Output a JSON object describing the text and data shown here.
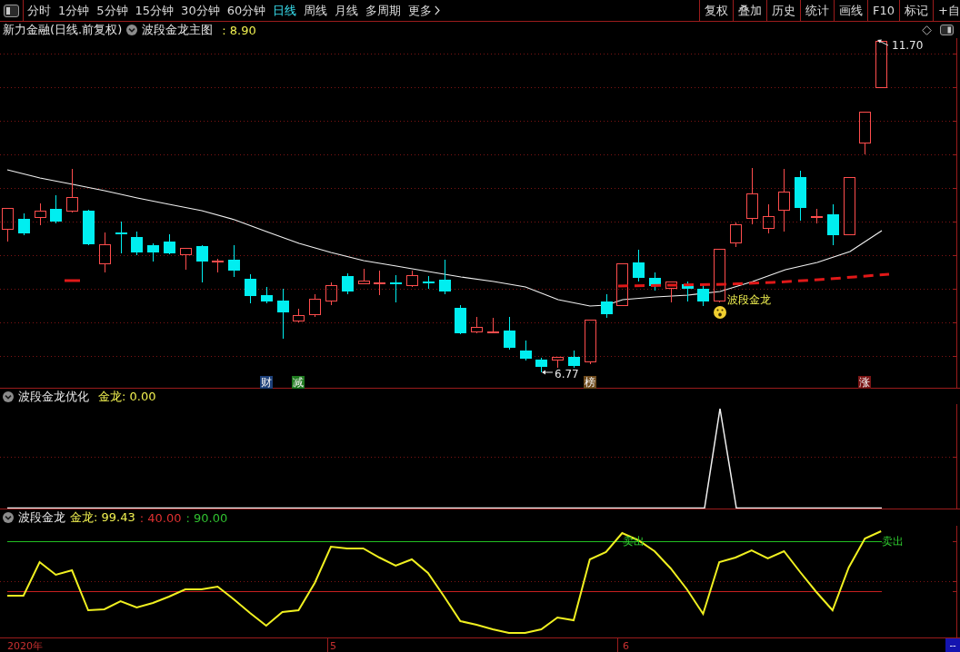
{
  "toolbar": {
    "period_tabs": [
      {
        "label": "分时",
        "selected": false,
        "kind": "period"
      },
      {
        "label": "1分钟",
        "selected": false,
        "kind": "period"
      },
      {
        "label": "5分钟",
        "selected": false,
        "kind": "period"
      },
      {
        "label": "15分钟",
        "selected": false,
        "kind": "period"
      },
      {
        "label": "30分钟",
        "selected": false,
        "kind": "period"
      },
      {
        "label": "60分钟",
        "selected": false,
        "kind": "period"
      },
      {
        "label": "日线",
        "selected": true,
        "kind": "period"
      },
      {
        "label": "周线",
        "selected": false,
        "kind": "period"
      },
      {
        "label": "月线",
        "selected": false,
        "kind": "period"
      },
      {
        "label": "多周期",
        "selected": false,
        "kind": "period"
      },
      {
        "label": "更多",
        "selected": false,
        "kind": "menu"
      }
    ],
    "buttons": [
      "复权",
      "叠加",
      "历史",
      "统计",
      "画线",
      "F10",
      "标记",
      "+自"
    ]
  },
  "main_chart": {
    "title": "新力金融(日线.前复权)",
    "indicator": "波段金龙主图",
    "reading": ": 8.90",
    "high_price": "11.70",
    "low_price": "6.77",
    "signal_label": "波段金龙",
    "event_tags": [
      {
        "text": "财",
        "color": "#1c3f78"
      },
      {
        "text": "减",
        "color": "#1f7a1f"
      },
      {
        "text": "榜",
        "color": "#6e4a1c"
      },
      {
        "text": "涨",
        "color": "#7a1414"
      }
    ]
  },
  "sub_chart_1": {
    "name": "波段金龙优化",
    "reading": "金龙: 0.00"
  },
  "sub_chart_2": {
    "name": "波段金龙",
    "readings": [
      {
        "text": "金龙: 99.43",
        "color": "#f0f050"
      },
      {
        "text": ": 40.00",
        "color": "#e03030"
      },
      {
        "text": ": 90.00",
        "color": "#30c030"
      }
    ],
    "sell_labels": [
      "卖出",
      "卖出"
    ]
  },
  "time_axis": [
    "2020年",
    "5",
    "6"
  ],
  "corner_button": "--"
}
